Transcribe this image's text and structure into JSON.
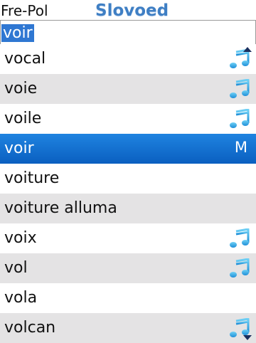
{
  "header": {
    "language_pair": "Fre-Pol",
    "logo_text": "Slovoed"
  },
  "search": {
    "value": "voir"
  },
  "list": {
    "items": [
      {
        "word": "vocal",
        "has_audio": true,
        "badge": ""
      },
      {
        "word": "voie",
        "has_audio": true,
        "badge": ""
      },
      {
        "word": "voile",
        "has_audio": true,
        "badge": ""
      },
      {
        "word": "voir",
        "has_audio": false,
        "badge": "M",
        "selected": true
      },
      {
        "word": "voiture",
        "has_audio": false,
        "badge": ""
      },
      {
        "word": "voiture alluma",
        "has_audio": false,
        "badge": ""
      },
      {
        "word": "voix",
        "has_audio": true,
        "badge": ""
      },
      {
        "word": "vol",
        "has_audio": true,
        "badge": ""
      },
      {
        "word": "vola",
        "has_audio": false,
        "badge": ""
      },
      {
        "word": "volcan",
        "has_audio": true,
        "badge": ""
      }
    ]
  },
  "icons": {
    "audio": "music-note-icon",
    "scroll_up": "scroll-up-arrow-icon",
    "scroll_down": "scroll-down-arrow-icon"
  },
  "colors": {
    "selection": "#1a73d6",
    "alt_row": "#e4e3e4",
    "logo": "#3f7fc4",
    "note_icon": "#2aa8e6"
  }
}
